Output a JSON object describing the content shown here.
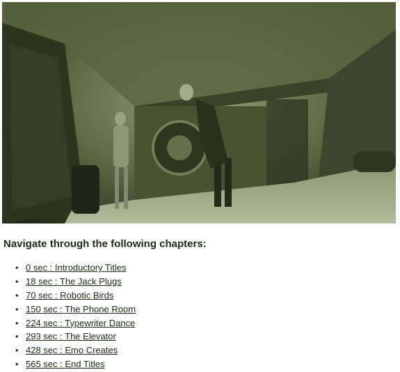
{
  "heading": "Navigate through the following chapters:",
  "chapters": [
    {
      "label": "0 sec : Introductory Titles"
    },
    {
      "label": "18 sec : The Jack Plugs"
    },
    {
      "label": "70 sec : Robotic Birds"
    },
    {
      "label": "150 sec : The Phone Room"
    },
    {
      "label": "224 sec : Typewriter Dance"
    },
    {
      "label": "293 sec : The Elevator"
    },
    {
      "label": "428 sec : Emo Creates"
    },
    {
      "label": "565 sec : End Titles"
    }
  ],
  "colors": {
    "text": "#1d2a14",
    "video_tint": "#3f4a2c"
  }
}
